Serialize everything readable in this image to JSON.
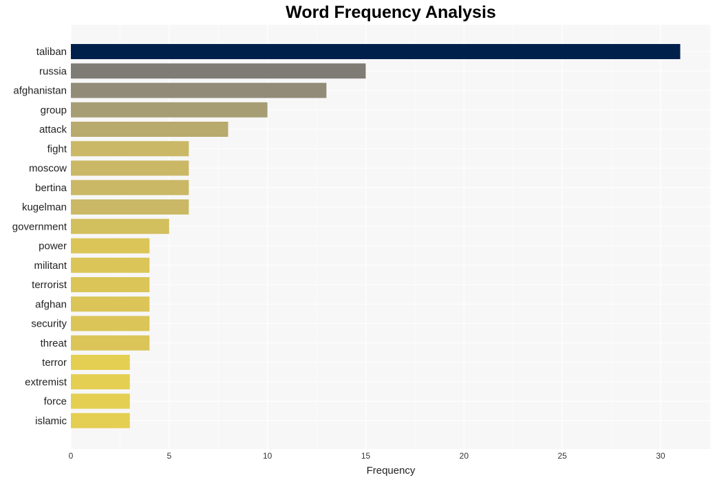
{
  "chart_data": {
    "type": "bar",
    "orientation": "horizontal",
    "title": "Word Frequency Analysis",
    "xlabel": "Frequency",
    "ylabel": "",
    "xlim": [
      0,
      32.5
    ],
    "xticks": [
      0,
      5,
      10,
      15,
      20,
      25,
      30
    ],
    "grid": true,
    "categories": [
      "taliban",
      "russia",
      "afghanistan",
      "group",
      "attack",
      "fight",
      "moscow",
      "bertina",
      "kugelman",
      "government",
      "power",
      "militant",
      "terrorist",
      "afghan",
      "security",
      "threat",
      "terror",
      "extremist",
      "force",
      "islamic"
    ],
    "values": [
      31,
      15,
      13,
      10,
      8,
      6,
      6,
      6,
      6,
      5,
      4,
      4,
      4,
      4,
      4,
      4,
      3,
      3,
      3,
      3
    ],
    "colors": [
      "#00204c",
      "#7f7c75",
      "#918b78",
      "#a69d75",
      "#b8a96d",
      "#cab866",
      "#cab866",
      "#cab866",
      "#cab866",
      "#d2bf5e",
      "#dbc559",
      "#dbc559",
      "#dbc559",
      "#dbc559",
      "#dbc559",
      "#dbc559",
      "#e4cf52",
      "#e4cf52",
      "#e4cf52",
      "#e4cf52"
    ]
  }
}
